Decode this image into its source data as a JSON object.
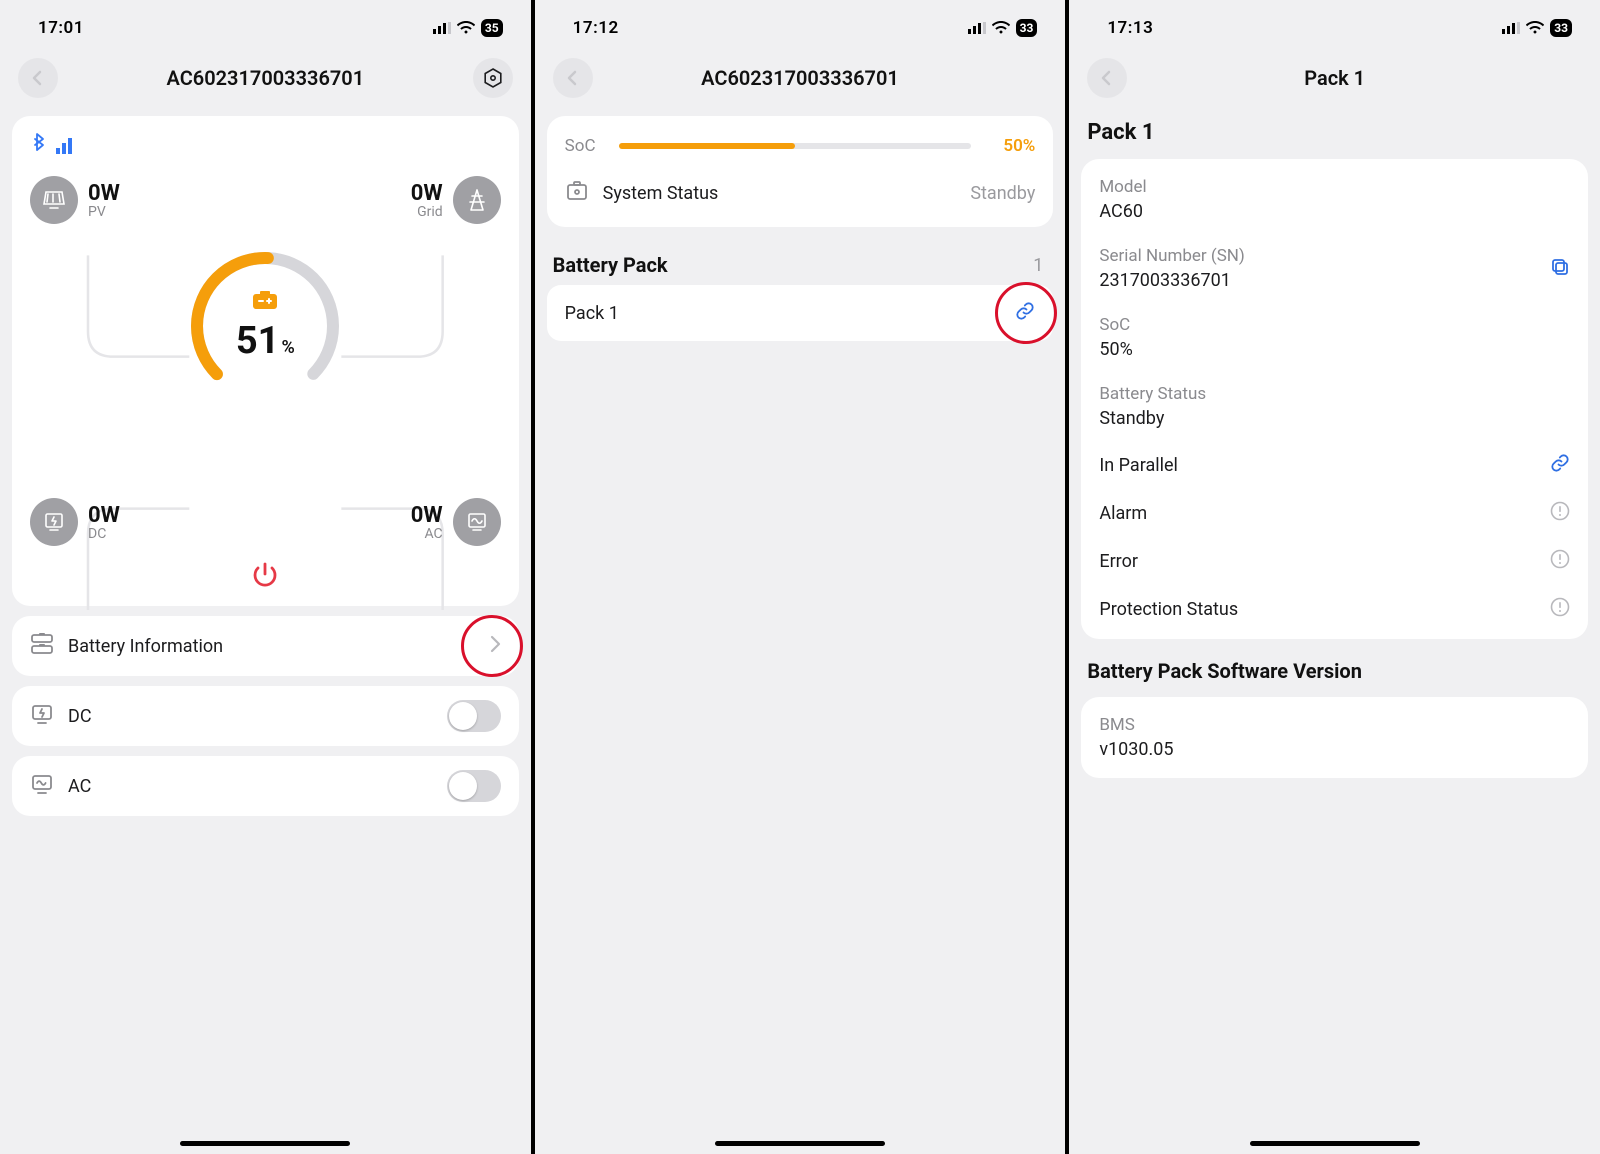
{
  "s1": {
    "time": "17:01",
    "battery_status_icon": "35",
    "title": "AC602317003336701",
    "pv": {
      "watt": "0W",
      "label": "PV"
    },
    "grid": {
      "watt": "0W",
      "label": "Grid"
    },
    "dc": {
      "watt": "0W",
      "label": "DC"
    },
    "ac": {
      "watt": "0W",
      "label": "AC"
    },
    "gauge_value": "51",
    "gauge_suffix": "%",
    "battery_info_label": "Battery Information",
    "dc_row_label": "DC",
    "ac_row_label": "AC"
  },
  "s2": {
    "time": "17:12",
    "battery_status_icon": "33",
    "title": "AC602317003336701",
    "soc_label": "SoC",
    "soc_pct_text": "50%",
    "soc_pct_value": 50,
    "system_status_label": "System Status",
    "system_status_value": "Standby",
    "pack_section": "Battery Pack",
    "pack_count": "1",
    "pack_row_label": "Pack 1"
  },
  "s3": {
    "time": "17:13",
    "battery_status_icon": "33",
    "title": "Pack 1",
    "section": "Pack 1",
    "model_k": "Model",
    "model_v": "AC60",
    "serial_k": "Serial Number (SN)",
    "serial_v": "2317003336701",
    "soc_k": "SoC",
    "soc_v": "50%",
    "batt_status_k": "Battery Status",
    "batt_status_v": "Standby",
    "in_parallel": "In Parallel",
    "alarm": "Alarm",
    "error": "Error",
    "protection": "Protection Status",
    "sw_section": "Battery Pack Software Version",
    "bms_k": "BMS",
    "bms_v": "v1030.05"
  }
}
